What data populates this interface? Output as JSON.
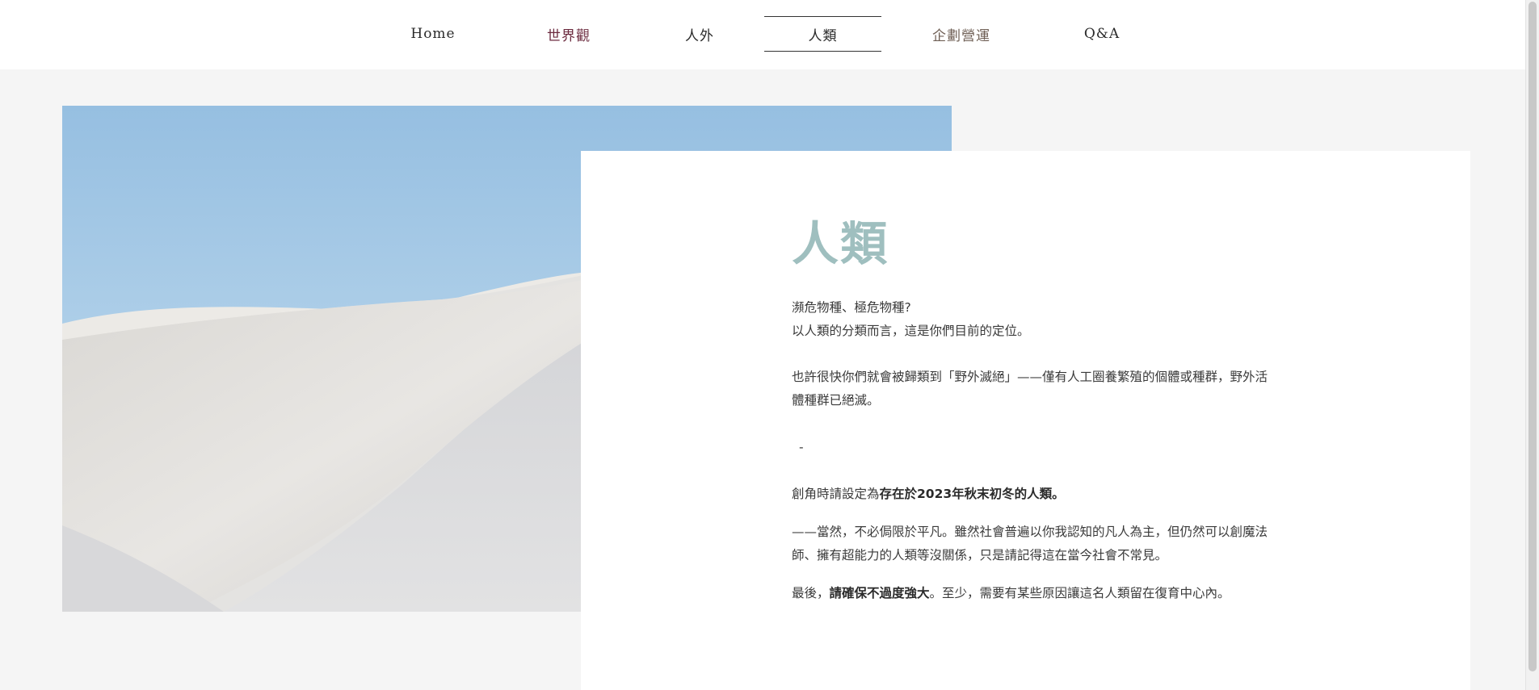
{
  "nav": {
    "items": [
      {
        "label": "Home"
      },
      {
        "label": "世界觀"
      },
      {
        "label": "人外"
      },
      {
        "label": "人類"
      },
      {
        "label": "企劃營運"
      },
      {
        "label": "Q&A"
      }
    ],
    "active_index": 3
  },
  "content": {
    "title": "人類",
    "line1": "瀕危物種、極危物種?",
    "line2": "以人類的分類而言，這是你們目前的定位。",
    "para2": "也許很快你們就會被歸類到「野外滅絕」——僅有人工圈養繁殖的個體或種群，野外活體種群已絕滅。",
    "separator": "-",
    "para3_prefix": "創角時請設定為",
    "para3_bold": "存在於2023年秋末初冬的人類。",
    "para4": "——當然，不必侷限於平凡。雖然社會普遍以你我認知的凡人為主，但仍然可以創魔法師、擁有超能力的人類等沒關係，只是請記得這在當今社會不常見。",
    "para5_prefix": "最後，",
    "para5_bold": "請確保不過度強大",
    "para5_suffix": "。至少，需要有某些原因讓這名人類留在復育中心內。"
  },
  "colors": {
    "title": "#9fbfbf",
    "page_bg": "#f5f5f5",
    "card_bg": "#ffffff",
    "nav_maroon": "#6b2a3e"
  },
  "image": {
    "subject": "white-sand-dune-under-blue-sky"
  }
}
